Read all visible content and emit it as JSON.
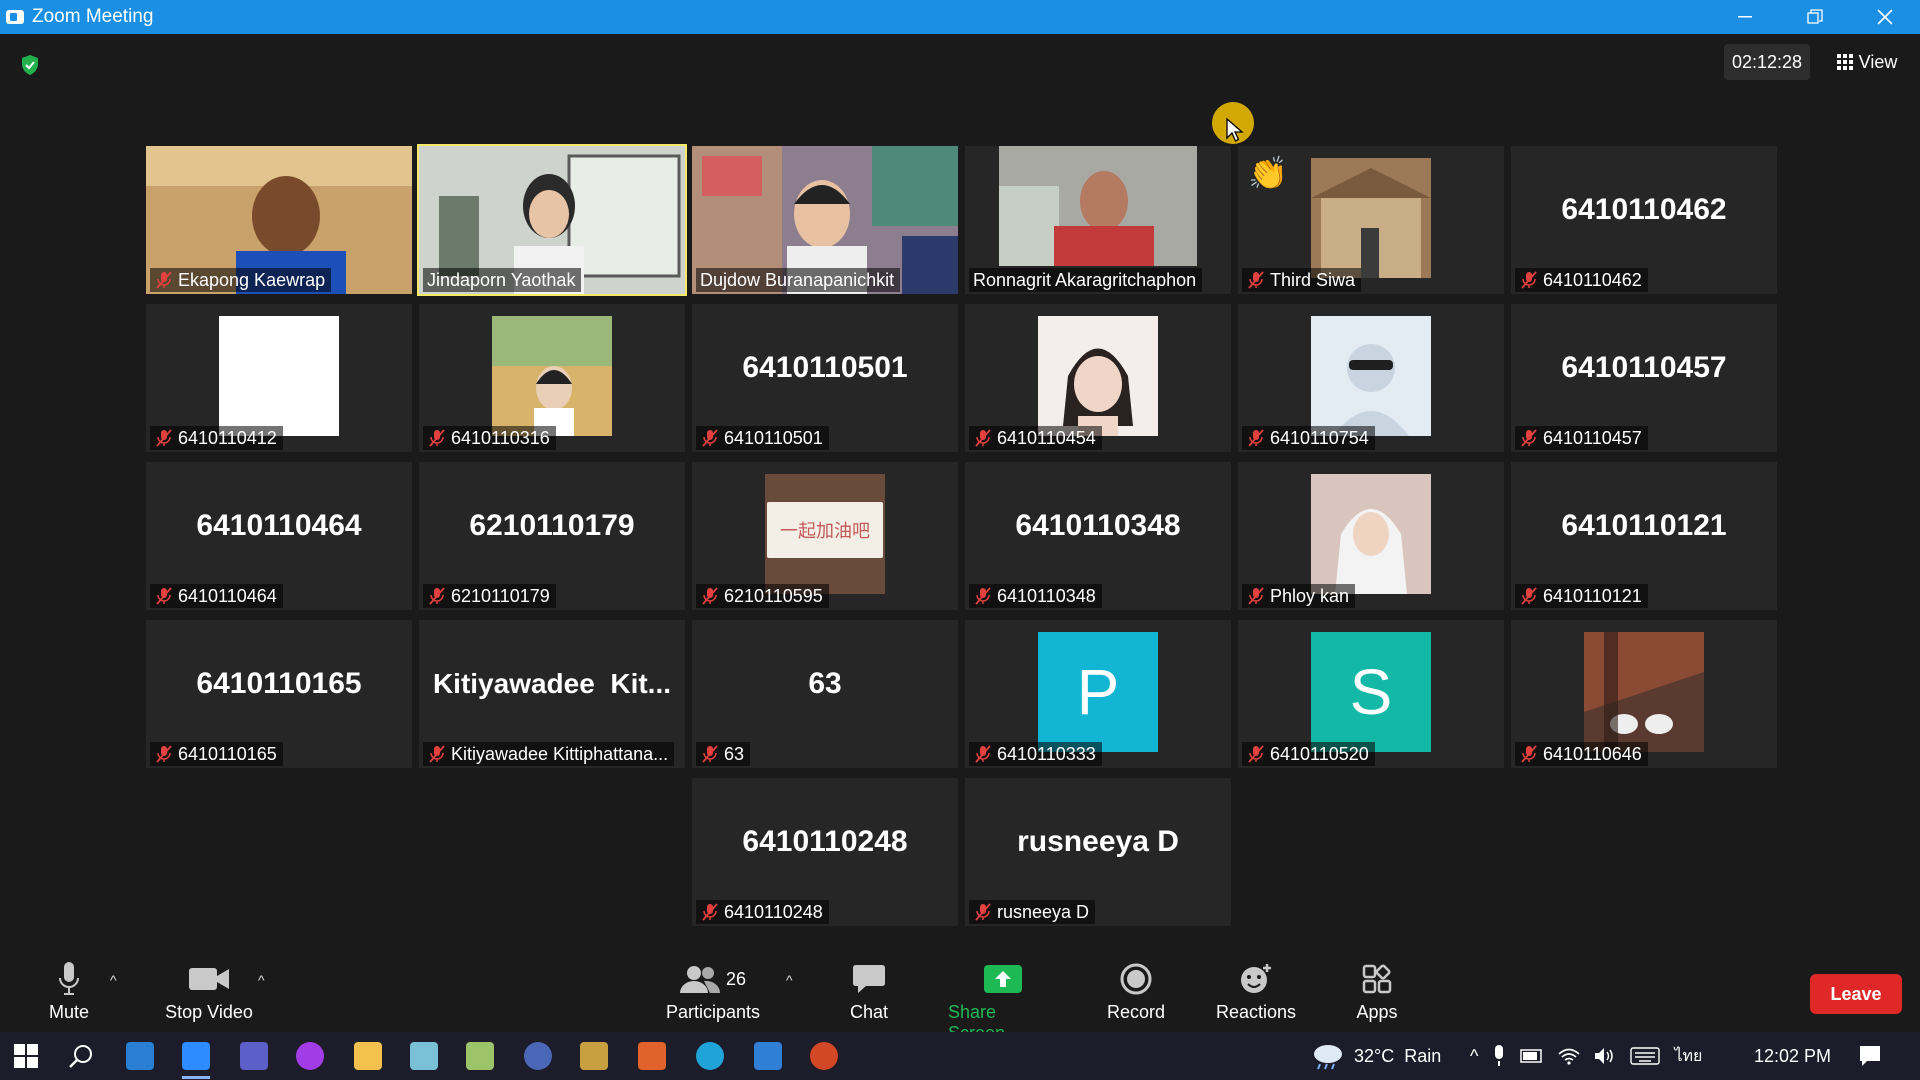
{
  "window": {
    "title": "Zoom Meeting"
  },
  "meeting": {
    "timer": "02:12:28",
    "view_label": "View"
  },
  "tiles": [
    {
      "big": "",
      "label": "Ekapong Kaewrap"
    },
    {
      "big": "",
      "label": "Jindaporn Yaothak"
    },
    {
      "big": "",
      "label": "Dujdow Buranapanichkit"
    },
    {
      "big": "",
      "label": "Ronnagrit Akaragritchaphon"
    },
    {
      "big": "",
      "label": "Third Siwa"
    },
    {
      "big": "6410110462",
      "label": "6410110462"
    },
    {
      "big": "",
      "label": "6410110412"
    },
    {
      "big": "",
      "label": "6410110316"
    },
    {
      "big": "6410110501",
      "label": "6410110501"
    },
    {
      "big": "",
      "label": "6410110454"
    },
    {
      "big": "",
      "label": "6410110754"
    },
    {
      "big": "6410110457",
      "label": "6410110457"
    },
    {
      "big": "6410110464",
      "label": "6410110464"
    },
    {
      "big": "6210110179",
      "label": "6210110179"
    },
    {
      "big": "",
      "label": "6210110595",
      "sign_text": "一起加油吧"
    },
    {
      "big": "6410110348",
      "label": "6410110348"
    },
    {
      "big": "",
      "label": "Phloy kan"
    },
    {
      "big": "6410110121",
      "label": "6410110121"
    },
    {
      "big": "6410110165",
      "label": "6410110165"
    },
    {
      "big": "Kitiyawadee  Kit...",
      "label": "Kitiyawadee Kittiphattana..."
    },
    {
      "big": "63",
      "label": "63"
    },
    {
      "big": "",
      "label": "6410110333",
      "avatar_letter": "P",
      "avatar_color": "#12b5d3"
    },
    {
      "big": "",
      "label": "6410110520",
      "avatar_letter": "S",
      "avatar_color": "#14b8a6"
    },
    {
      "big": "",
      "label": "6410110646"
    },
    {
      "big": "6410110248",
      "label": "6410110248"
    },
    {
      "big": "rusneeya D",
      "label": "rusneeya D"
    }
  ],
  "toolbar": {
    "mute": "Mute",
    "stop_video": "Stop Video",
    "participants": "Participants",
    "participants_count": "26",
    "chat": "Chat",
    "share": "Share Screen",
    "record": "Record",
    "reactions": "Reactions",
    "apps": "Apps",
    "leave": "Leave"
  },
  "taskbar": {
    "weather": "32°C  Rain",
    "language": "ไทย",
    "time": "12:02 PM"
  },
  "colors": {
    "titlebar": "#1a8fe3",
    "share_green": "#1db954",
    "leave_red": "#e02828",
    "active_speaker": "#f3e86a"
  }
}
